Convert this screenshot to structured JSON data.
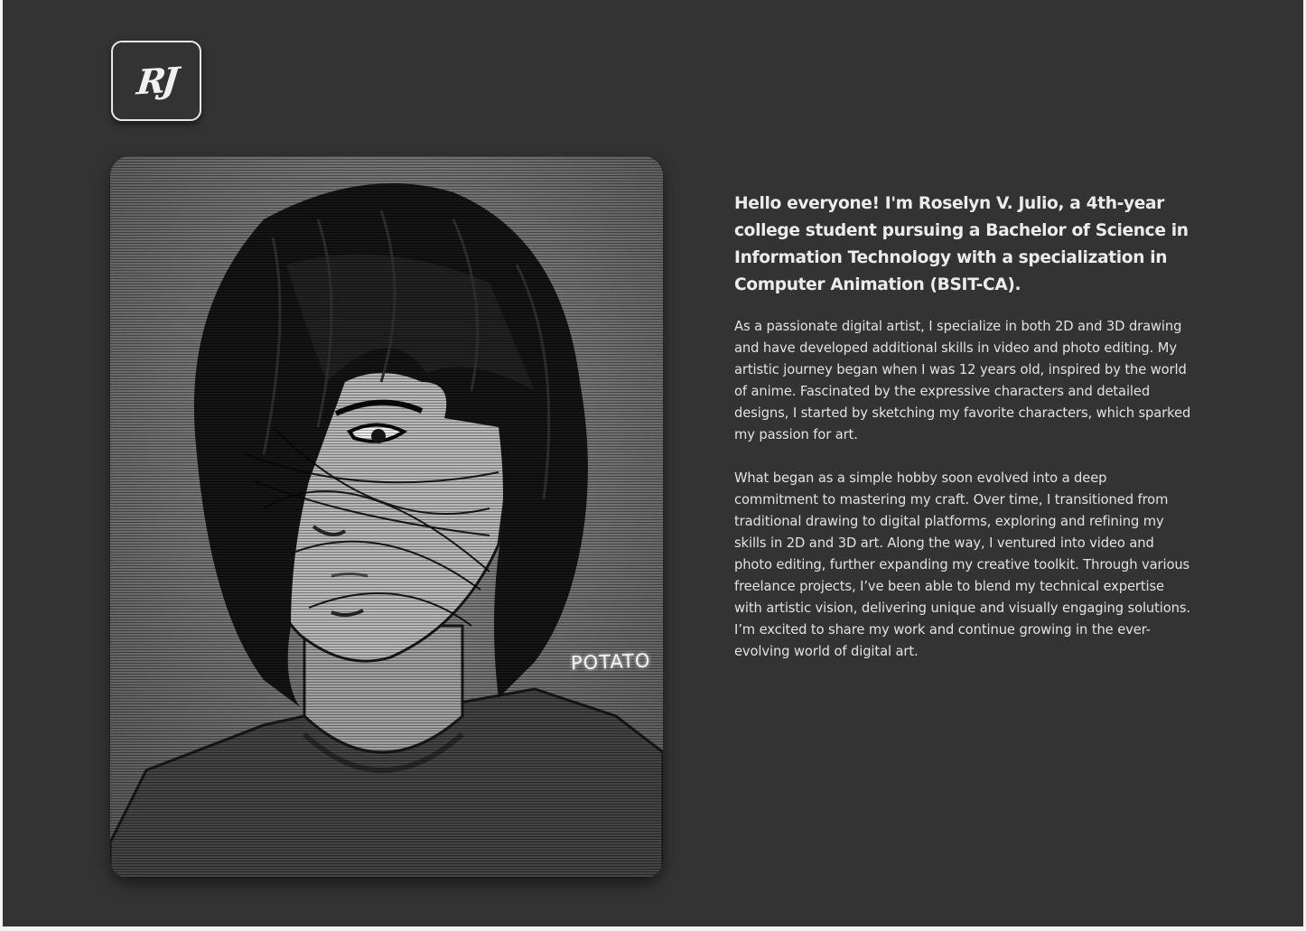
{
  "logo": {
    "text": "RJ"
  },
  "portrait": {
    "signature": "POTATO",
    "alt": "Illustrated monochrome self-portrait of a person with shaggy dark hair covering one eye"
  },
  "about": {
    "intro": "Hello everyone! I'm Roselyn V. Julio, a 4th-year college student pursuing a Bachelor of Science in Information Technology with a specialization in Computer Animation (BSIT-CA).",
    "paragraphs": [
      "As a passionate digital artist, I specialize in both 2D and 3D drawing and have developed additional skills in video and photo editing. My artistic journey began when I was 12 years old, inspired by the world of anime. Fascinated by the expressive characters and detailed designs, I started by sketching my favorite characters, which sparked my passion for art.",
      "What began as a simple hobby soon evolved into a deep commitment to mastering my craft. Over time, I transitioned from traditional drawing to digital platforms, exploring and refining my skills in 2D and 3D art. Along the way, I ventured into video and photo editing, further expanding my creative toolkit. Through various freelance projects, I’ve been able to blend my technical expertise with artistic vision, delivering unique and visually engaging solutions. I’m excited to share my work and continue growing in the ever-evolving world of digital art."
    ]
  },
  "colors": {
    "background": "#333333",
    "text": "#ececec",
    "accent": "#e8e8e8"
  }
}
